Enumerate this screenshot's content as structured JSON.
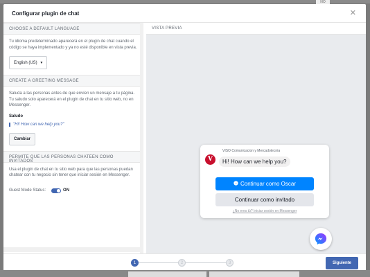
{
  "dialog": {
    "title": "Configurar plugin de chat"
  },
  "background": {
    "badge": "NO"
  },
  "language_section": {
    "heading": "CHOOSE A DEFAULT LANGUAGE",
    "description": "Tu idioma predeterminado aparecerá en el plugin de chat cuando el código se haya implementado y ya no esté disponible en vista previa.",
    "selected_language": "English (US)"
  },
  "greeting_section": {
    "heading": "CREATE A GREETING MESSAGE",
    "description": "Saluda a las personas antes de que envíen un mensaje a tu página. Tu saludo solo aparecerá en el plugin de chat en tu sitio web, no en Messenger.",
    "label": "Saludo",
    "greeting": "\"Hi! How can we help you?\"",
    "change_button": "Cambiar"
  },
  "guest_section": {
    "heading": "PERMITE QUE LAS PERSONAS CHATEEN COMO INVITADOS",
    "description": "Usa el plugin de chat en tu sitio web para que las personas puedan chatear con tu negocio sin tener que iniciar sesión en Messenger.",
    "status_label": "Guest Mode Status:",
    "status_value": "ON"
  },
  "preview": {
    "heading": "VISTA PREVIA",
    "page_name": "VISO Comunicacion y Mercadotecnia",
    "avatar_letter": "V",
    "message": "Hi! How can we help you?",
    "continue_as": "Continuar como Oscar",
    "continue_guest": "Continuar como invitado",
    "not_you": "¿No eres tú? Iniciar sesión en Messenger"
  },
  "footer": {
    "steps": [
      "1",
      "2",
      "3"
    ],
    "active_step": 1,
    "next_button": "Siguiente"
  },
  "colors": {
    "accent": "#4267b2",
    "messenger_blue": "#0084ff",
    "brand_red": "#c8102e"
  }
}
